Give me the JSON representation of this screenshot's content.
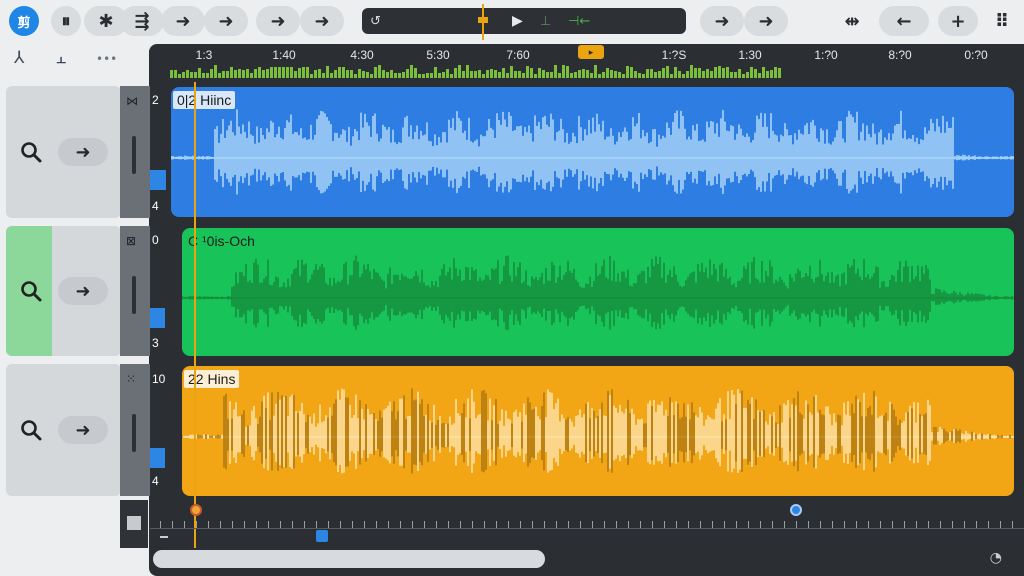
{
  "toolbar": {
    "app_icon_text": "剪",
    "pause_icon": "⏸",
    "snap_icon": "✱",
    "split_icon": "⇶",
    "nav_arrow": "➜",
    "transport_loop": "↺",
    "transport_marker": "⊣",
    "transport_play": "▶",
    "transport_marker2": "⊥",
    "transport_back": "⊣←",
    "zoom_icon": "⇹",
    "left_arrow_pill": "←",
    "plus_pill": "+",
    "grid_icon": "⠿"
  },
  "subtools": {
    "tool1": "⅄",
    "tool2": "⫠",
    "tool3": "•••"
  },
  "ruler": {
    "labels": [
      "1:3",
      "1:40",
      "4:30",
      "5:30",
      "7:60",
      "1:?S",
      "1:30",
      "1:?0",
      "8:?0",
      "0:?0"
    ],
    "flag_text": "▸"
  },
  "tracks": [
    {
      "number_top": "2",
      "number_bottom": "4",
      "icon": "⋈",
      "clip_name": "0|2 Hiinc",
      "color": "#2e7de3",
      "wave_color": "#a9d4f7"
    },
    {
      "number_top": "0",
      "number_bottom": "3",
      "icon": "⊠",
      "clip_name": "C ¹0is-Och",
      "color": "#18c45a",
      "wave_color": "#168c3c"
    },
    {
      "number_top": "10",
      "number_bottom": "4",
      "icon": "⁙",
      "clip_name": "22 Hins",
      "color": "#f2a616",
      "wave_color": "#fde3a8"
    }
  ],
  "header_controls": {
    "search_icon": "search",
    "go_icon": "➜"
  },
  "footer": {
    "end_icon": "◔",
    "corner_icon": "■"
  },
  "colors": {
    "accent": "#1f86e6",
    "playhead": "#e9a40f",
    "overview": "#7cbf3a"
  }
}
